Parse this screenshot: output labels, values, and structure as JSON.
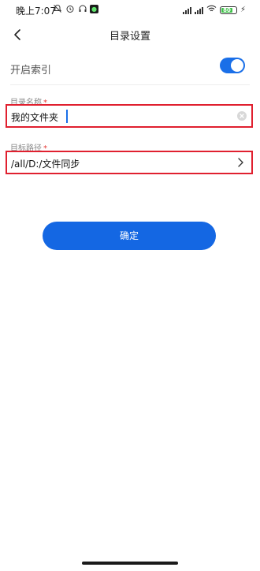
{
  "status_bar": {
    "time": "晚上7:07",
    "battery_label": "80",
    "battery_level": 0.8,
    "icons_left": [
      "mute-icon",
      "alarm-icon",
      "headphone-icon",
      "app-icon"
    ],
    "icons_right": [
      "signal-icon",
      "signal-icon",
      "wifi-icon",
      "battery-icon",
      "charging-icon"
    ]
  },
  "header": {
    "title": "目录设置",
    "back_icon": "chevron-left-icon"
  },
  "index_toggle": {
    "label": "开启索引",
    "enabled": true,
    "color": "#1a6fe8"
  },
  "folder_name": {
    "label": "目录名称",
    "required_mark": "*",
    "value": "我的文件夹",
    "clear_icon": "clear-icon"
  },
  "target_path": {
    "label": "目标路径",
    "required_mark": "*",
    "value": "/all/D:/文件同步",
    "chevron_icon": "chevron-right-icon"
  },
  "confirm_button": {
    "label": "确定",
    "color": "#1467e3"
  },
  "highlight_color": "#e0202f"
}
